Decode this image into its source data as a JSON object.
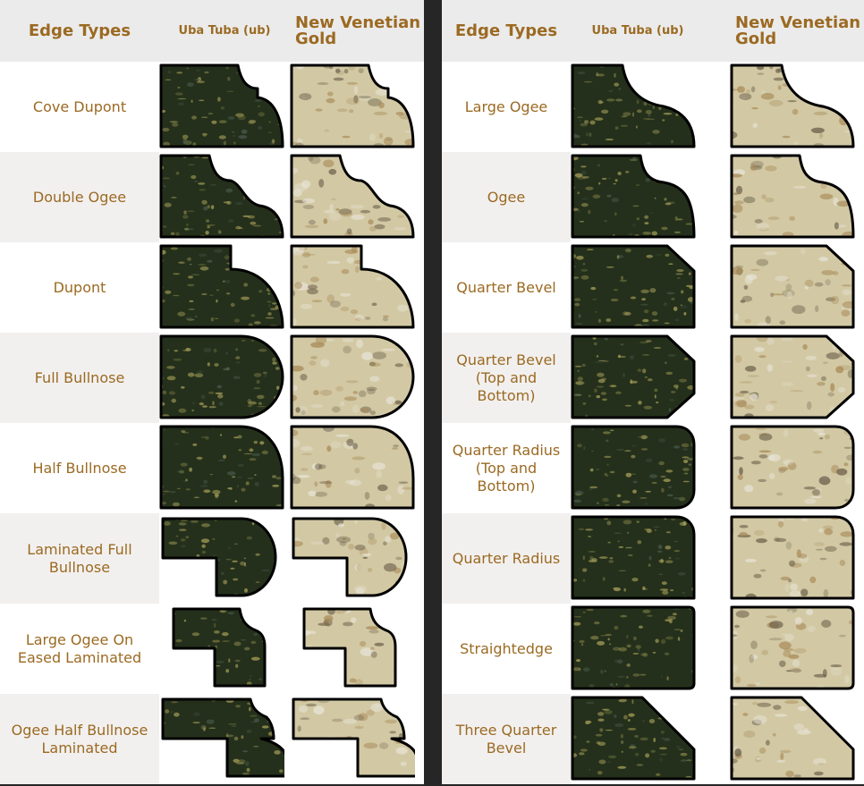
{
  "colors": {
    "heading_text": "#9b6a22",
    "header_bg": "#ebebeb",
    "alt_row_bg": "#f2f0ef",
    "divider": "#262626",
    "uba_tuba_base": "#1f2a17",
    "uba_tuba_fleck": "#a8a05a",
    "venetian_gold_base": "#cfc6a4",
    "venetian_gold_fleck": "#6b5f4a"
  },
  "left_table": {
    "headers": {
      "edge": "Edge Types",
      "uba": "Uba Tuba (ub)",
      "nvg": "New Venetian Gold"
    },
    "rows": [
      {
        "label": "Cove Dupont",
        "shape": "cove-dupont"
      },
      {
        "label": "Double Ogee",
        "shape": "double-ogee"
      },
      {
        "label": "Dupont",
        "shape": "dupont"
      },
      {
        "label": "Full Bullnose",
        "shape": "full-bullnose"
      },
      {
        "label": "Half Bullnose",
        "shape": "half-bullnose"
      },
      {
        "label": "Laminated Full\nBullnose",
        "shape": "laminated-full-bullnose"
      },
      {
        "label": "Large Ogee On\nEased Laminated",
        "shape": "large-ogee-eased-laminated"
      },
      {
        "label": "Ogee Half Bullnose\nLaminated",
        "shape": "ogee-half-bullnose-laminated"
      }
    ]
  },
  "right_table": {
    "headers": {
      "edge": "Edge Types",
      "uba": "Uba Tuba (ub)",
      "nvg": "New Venetian Gold"
    },
    "rows": [
      {
        "label": "Large Ogee",
        "shape": "large-ogee"
      },
      {
        "label": "Ogee",
        "shape": "ogee"
      },
      {
        "label": "Quarter Bevel",
        "shape": "quarter-bevel"
      },
      {
        "label": "Quarter Bevel\n(Top and\nBottom)",
        "shape": "quarter-bevel-tb"
      },
      {
        "label": "Quarter Radius\n(Top and\nBottom)",
        "shape": "quarter-radius-tb"
      },
      {
        "label": "Quarter Radius",
        "shape": "quarter-radius"
      },
      {
        "label": "Straightedge",
        "shape": "straightedge"
      },
      {
        "label": "Three Quarter\nBevel",
        "shape": "three-quarter-bevel"
      }
    ]
  }
}
